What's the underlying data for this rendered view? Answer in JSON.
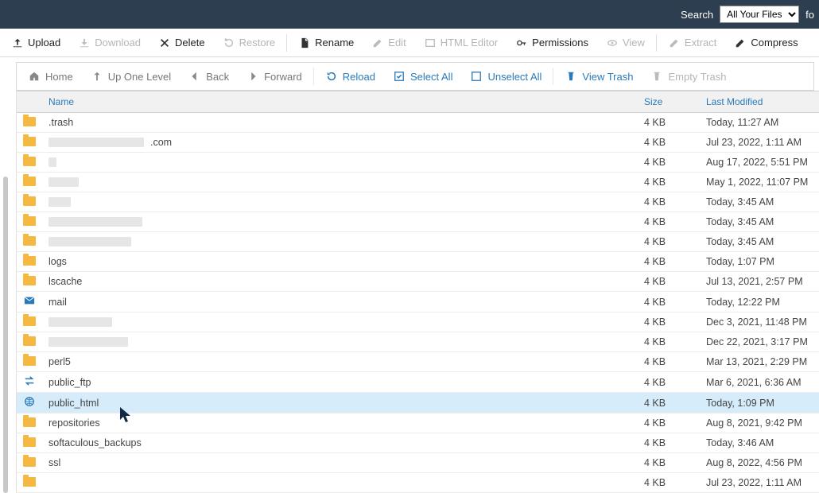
{
  "topbar": {
    "search_label": "Search",
    "search_select": "All Your Files",
    "for_label": "fo"
  },
  "toolbar1": {
    "upload": "Upload",
    "download": "Download",
    "delete": "Delete",
    "restore": "Restore",
    "rename": "Rename",
    "edit": "Edit",
    "html_editor": "HTML Editor",
    "permissions": "Permissions",
    "view": "View",
    "extract": "Extract",
    "compress": "Compress"
  },
  "toolbar2": {
    "home": "Home",
    "up": "Up One Level",
    "back": "Back",
    "forward": "Forward",
    "reload": "Reload",
    "select_all": "Select All",
    "unselect_all": "Unselect All",
    "view_trash": "View Trash",
    "empty_trash": "Empty Trash"
  },
  "headers": {
    "name": "Name",
    "size": "Size",
    "modified": "Last Modified"
  },
  "rows": [
    {
      "icon": "folder",
      "name": ".trash",
      "mask_w": 0,
      "size": "4 KB",
      "modified": "Today, 11:27 AM",
      "selected": false
    },
    {
      "icon": "folder",
      "name": ".com",
      "mask_w": 120,
      "size": "4 KB",
      "modified": "Jul 23, 2022, 1:11 AM",
      "selected": false,
      "suffix": true
    },
    {
      "icon": "folder",
      "name": "",
      "mask_w": 10,
      "size": "4 KB",
      "modified": "Aug 17, 2022, 5:51 PM",
      "selected": false
    },
    {
      "icon": "folder",
      "name": "",
      "mask_w": 38,
      "size": "4 KB",
      "modified": "May 1, 2022, 11:07 PM",
      "selected": false
    },
    {
      "icon": "folder",
      "name": "",
      "mask_w": 28,
      "size": "4 KB",
      "modified": "Today, 3:45 AM",
      "selected": false
    },
    {
      "icon": "folder",
      "name": "",
      "mask_w": 118,
      "size": "4 KB",
      "modified": "Today, 3:45 AM",
      "selected": false
    },
    {
      "icon": "folder",
      "name": "",
      "mask_w": 104,
      "size": "4 KB",
      "modified": "Today, 3:45 AM",
      "selected": false
    },
    {
      "icon": "folder",
      "name": "logs",
      "mask_w": 0,
      "size": "4 KB",
      "modified": "Today, 1:07 PM",
      "selected": false
    },
    {
      "icon": "folder",
      "name": "lscache",
      "mask_w": 0,
      "size": "4 KB",
      "modified": "Jul 13, 2021, 2:57 PM",
      "selected": false
    },
    {
      "icon": "mail",
      "name": "mail",
      "mask_w": 0,
      "size": "4 KB",
      "modified": "Today, 12:22 PM",
      "selected": false
    },
    {
      "icon": "folder",
      "name": "",
      "mask_w": 80,
      "size": "4 KB",
      "modified": "Dec 3, 2021, 11:48 PM",
      "selected": false
    },
    {
      "icon": "folder",
      "name": "",
      "mask_w": 100,
      "size": "4 KB",
      "modified": "Dec 22, 2021, 3:17 PM",
      "selected": false
    },
    {
      "icon": "folder",
      "name": "perl5",
      "mask_w": 0,
      "size": "4 KB",
      "modified": "Mar 13, 2021, 2:29 PM",
      "selected": false
    },
    {
      "icon": "ftp",
      "name": "public_ftp",
      "mask_w": 0,
      "size": "4 KB",
      "modified": "Mar 6, 2021, 6:36 AM",
      "selected": false
    },
    {
      "icon": "globe",
      "name": "public_html",
      "mask_w": 0,
      "size": "4 KB",
      "modified": "Today, 1:09 PM",
      "selected": true
    },
    {
      "icon": "folder",
      "name": "repositories",
      "mask_w": 0,
      "size": "4 KB",
      "modified": "Aug 8, 2021, 9:42 PM",
      "selected": false
    },
    {
      "icon": "folder",
      "name": "softaculous_backups",
      "mask_w": 0,
      "size": "4 KB",
      "modified": "Today, 3:46 AM",
      "selected": false
    },
    {
      "icon": "folder",
      "name": "ssl",
      "mask_w": 0,
      "size": "4 KB",
      "modified": "Aug 8, 2022, 4:56 PM",
      "selected": false
    },
    {
      "icon": "folder",
      "name": "",
      "mask_w": 0,
      "size": "4 KB",
      "modified": "Jul 23, 2022, 1:11 AM",
      "selected": false
    }
  ]
}
